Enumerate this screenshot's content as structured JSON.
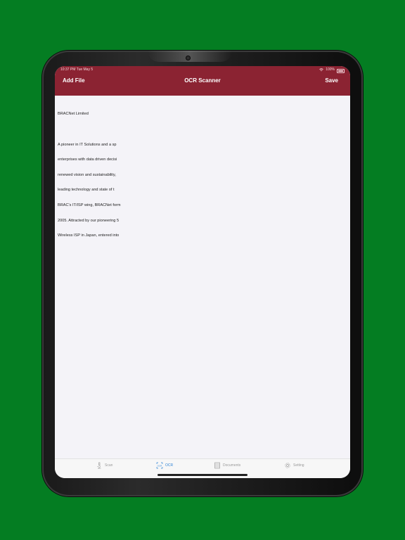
{
  "status_bar": {
    "time_date": "10:37 PM   Tue May 5",
    "battery_percent": "100%"
  },
  "nav": {
    "left_label": "Add File",
    "title": "OCR Scanner",
    "right_label": "Save"
  },
  "ocr_result": {
    "lines": [
      "BRACNet Limited",
      "",
      "A pioneer in IT Solutions and a sp",
      "enterprises with data driven decisi",
      "renewed vision and sustainability,",
      "leading technology and state of t",
      "BRAC's IT/ISP wing, BRACNet form",
      "2005. Attracted by our pioneering 5",
      "Wireless ISP in Japan, entered into"
    ]
  },
  "tabs": [
    {
      "label": "Scan",
      "icon": "microscope-icon",
      "active": false
    },
    {
      "label": "OCR",
      "icon": "ocr-icon",
      "active": true
    },
    {
      "label": "Documents",
      "icon": "documents-icon",
      "active": false
    },
    {
      "label": "Setting",
      "icon": "gear-icon",
      "active": false
    }
  ],
  "colors": {
    "background": "#047d22",
    "nav_bar": "#8b2332",
    "active_tab": "#2f84d6",
    "inactive_tab": "#9a9a9a"
  }
}
